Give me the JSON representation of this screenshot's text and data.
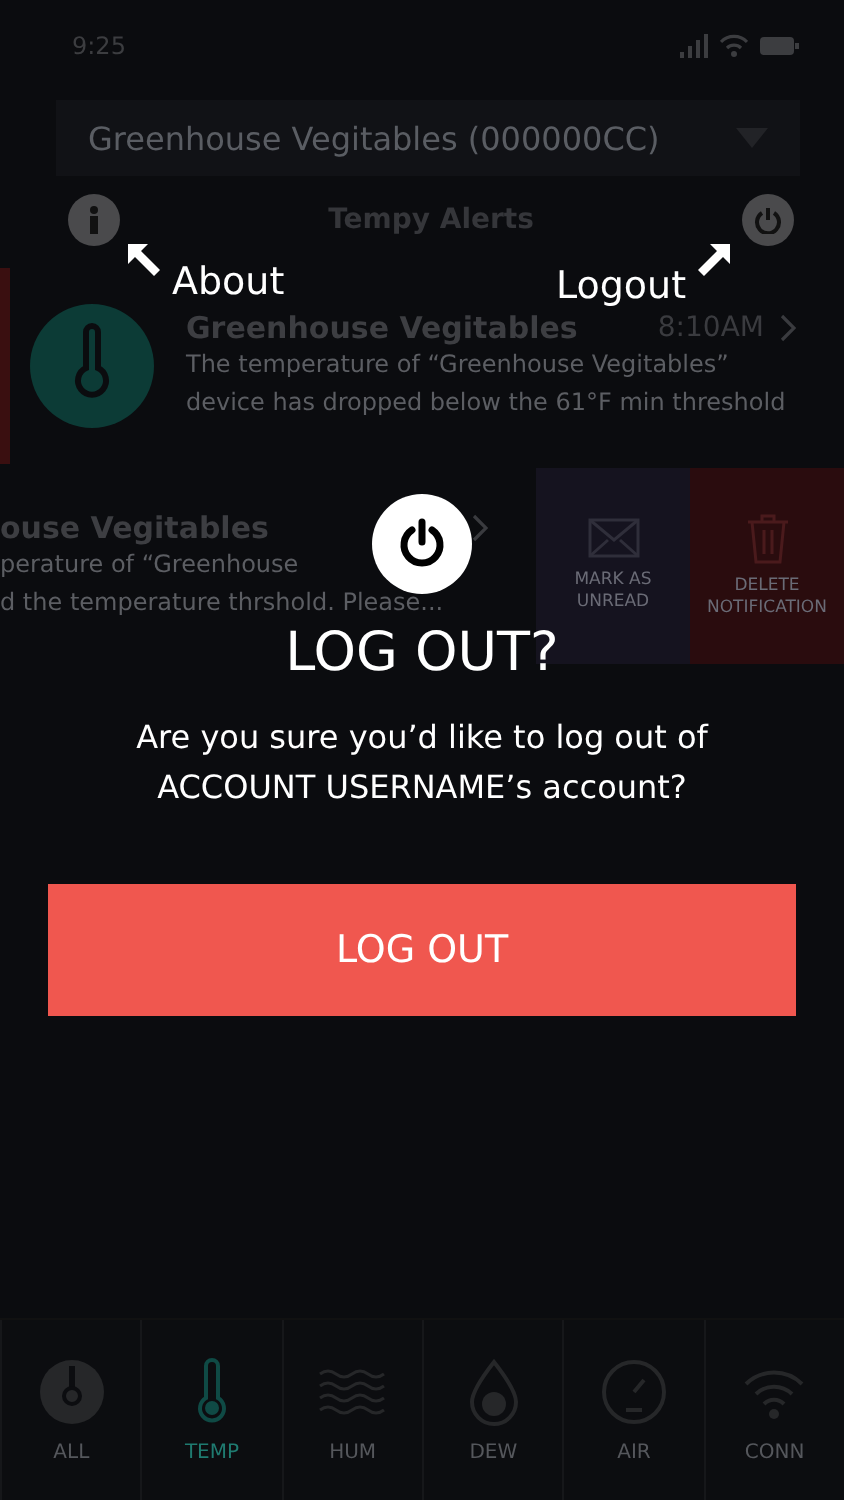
{
  "status_bar": {
    "time": "9:25"
  },
  "device_select": {
    "value": "Greenhouse Vegitables (000000CC)"
  },
  "header": {
    "title": "Tempy Alerts"
  },
  "annotations": [
    {
      "kind": "left",
      "label": "About"
    },
    {
      "kind": "right",
      "label": "Logout"
    }
  ],
  "alerts": [
    {
      "kind": "full",
      "unread": true,
      "title": "Greenhouse Vegitables",
      "time": "8:10AM",
      "lines": [
        "The temperature of “Greenhouse Vegitables”",
        "device has dropped below the 61°F min threshold"
      ]
    },
    {
      "kind": "swiped",
      "unread": false,
      "title": "ouse Vegitables",
      "lines": [
        "perature of “Greenhouse",
        "d the temperature thrshold. Please..."
      ],
      "actions": [
        {
          "kind": "mark",
          "label": "MARK AS UNREAD"
        },
        {
          "kind": "delete",
          "label": "DELETE NOTIFICATION"
        }
      ]
    }
  ],
  "dialog": {
    "title": "LOG OUT?",
    "message": "Are you sure you’d like to log out of ACCOUNT USERNAME’s account?",
    "button": "LOG OUT"
  },
  "tabs": [
    {
      "kind": "all",
      "label": "ALL",
      "selected": false
    },
    {
      "kind": "temp",
      "label": "TEMP",
      "selected": true
    },
    {
      "kind": "hum",
      "label": "HUM",
      "selected": false
    },
    {
      "kind": "dew",
      "label": "DEW",
      "selected": false
    },
    {
      "kind": "air",
      "label": "AIR",
      "selected": false
    },
    {
      "kind": "conn",
      "label": "CONN",
      "selected": false
    }
  ]
}
